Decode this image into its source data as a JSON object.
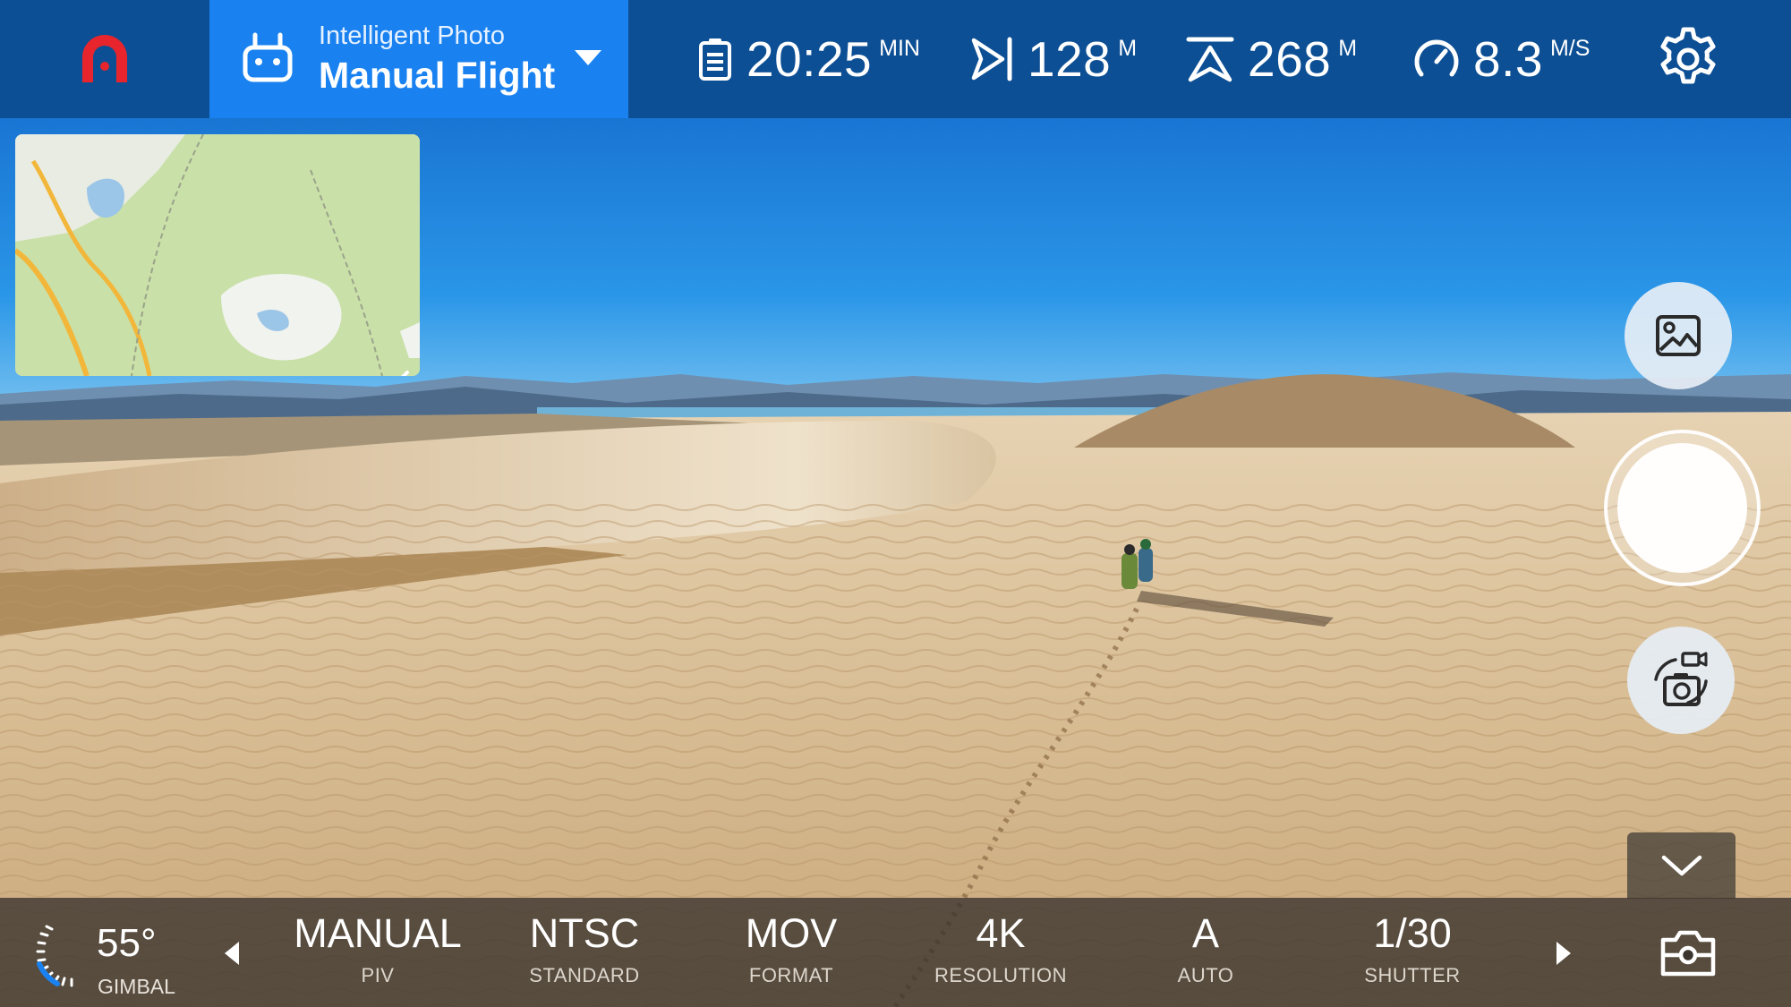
{
  "app": {
    "logo_icon": "app-logo-icon",
    "accent": "#1a82f0",
    "topbar_color": "#0d4f94"
  },
  "mode": {
    "sub_label": "Intelligent Photo",
    "main_label": "Manual Flight",
    "icon": "controller-icon"
  },
  "telemetry": {
    "battery": {
      "value": "20:25",
      "unit": "MIN",
      "icon": "battery-icon"
    },
    "distance": {
      "value": "128",
      "unit": "M",
      "icon": "distance-icon"
    },
    "altitude": {
      "value": "268",
      "unit": "M",
      "icon": "altitude-icon"
    },
    "speed": {
      "value": "8.3",
      "unit": "M/S",
      "icon": "speedometer-icon"
    }
  },
  "gimbal": {
    "value": "55°",
    "label": "GIMBAL"
  },
  "camera_params": [
    {
      "value": "MANUAL",
      "label": "PIV"
    },
    {
      "value": "NTSC",
      "label": "STANDARD"
    },
    {
      "value": "MOV",
      "label": "FORMAT"
    },
    {
      "value": "4K",
      "label": "RESOLUTION"
    },
    {
      "value": "A",
      "label": "AUTO"
    },
    {
      "value": "1/30",
      "label": "SHUTTER"
    }
  ]
}
